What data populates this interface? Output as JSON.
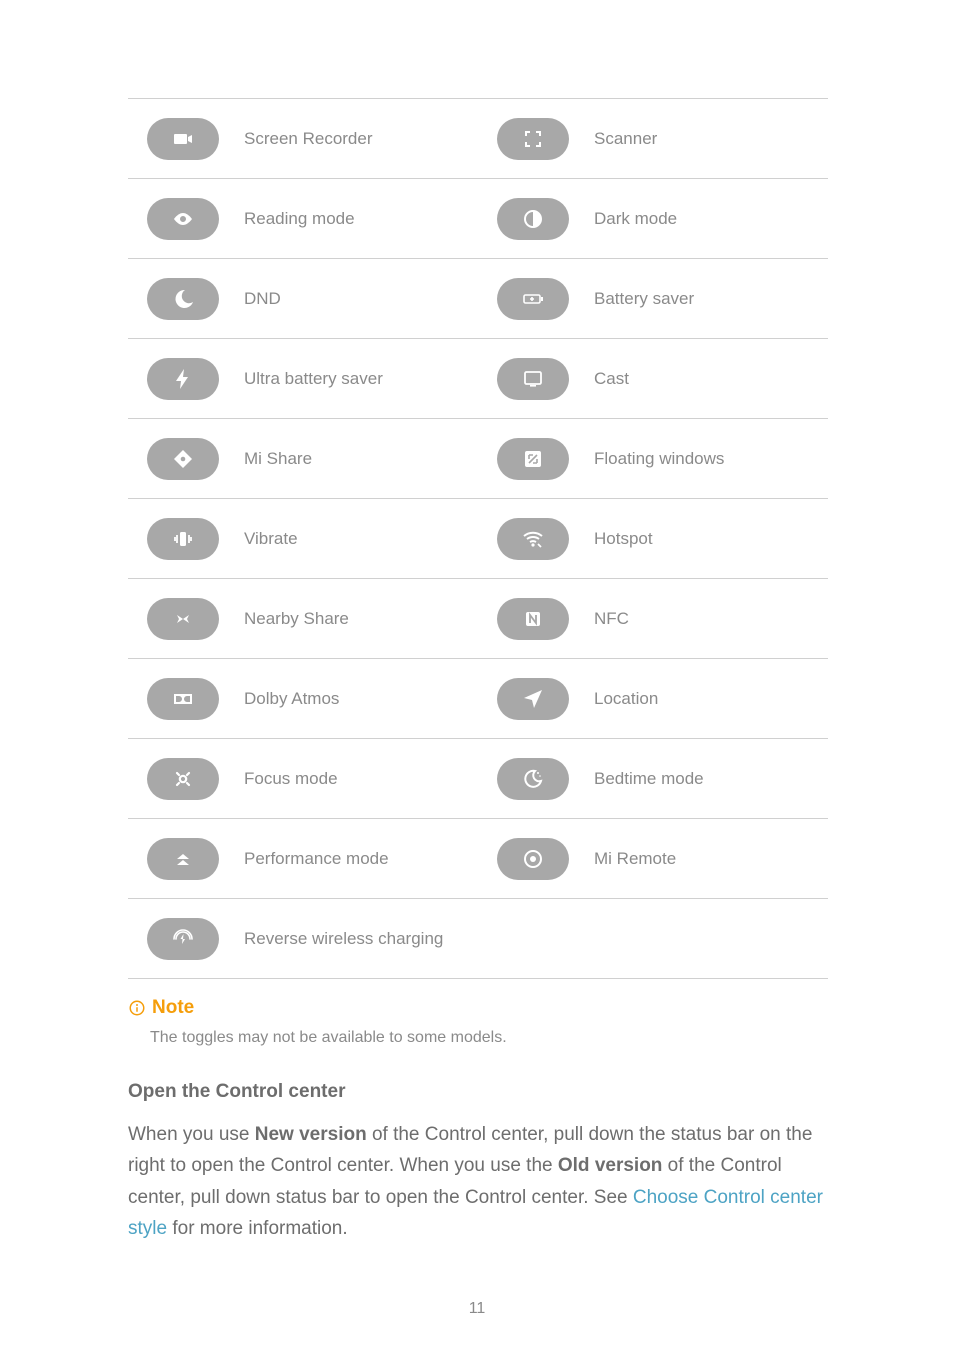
{
  "rows": [
    {
      "leftIcon": "camera-icon",
      "leftLabel": "Screen Recorder",
      "rightIcon": "scan-icon",
      "rightLabel": "Scanner"
    },
    {
      "leftIcon": "eye-icon",
      "leftLabel": "Reading mode",
      "rightIcon": "dark-mode-icon",
      "rightLabel": "Dark mode"
    },
    {
      "leftIcon": "moon-icon",
      "leftLabel": "DND",
      "rightIcon": "battery-plus-icon",
      "rightLabel": "Battery saver"
    },
    {
      "leftIcon": "bolt-icon",
      "leftLabel": "Ultra battery saver",
      "rightIcon": "cast-icon",
      "rightLabel": "Cast"
    },
    {
      "leftIcon": "share-diamond-icon",
      "leftLabel": "Mi Share",
      "rightIcon": "floating-window-icon",
      "rightLabel": "Floating windows"
    },
    {
      "leftIcon": "vibrate-icon",
      "leftLabel": "Vibrate",
      "rightIcon": "hotspot-icon",
      "rightLabel": "Hotspot"
    },
    {
      "leftIcon": "nearby-icon",
      "leftLabel": "Nearby Share",
      "rightIcon": "nfc-icon",
      "rightLabel": "NFC"
    },
    {
      "leftIcon": "dolby-icon",
      "leftLabel": "Dolby Atmos",
      "rightIcon": "location-icon",
      "rightLabel": "Location"
    },
    {
      "leftIcon": "focus-icon",
      "leftLabel": "Focus mode",
      "rightIcon": "bedtime-icon",
      "rightLabel": "Bedtime mode"
    },
    {
      "leftIcon": "performance-icon",
      "leftLabel": "Performance mode",
      "rightIcon": "remote-icon",
      "rightLabel": "Mi Remote"
    },
    {
      "leftIcon": "reverse-charge-icon",
      "leftLabel": "Reverse wireless charging",
      "rightIcon": "",
      "rightLabel": ""
    }
  ],
  "note": {
    "heading": "Note",
    "body": "The toggles may not be available to some models."
  },
  "section": {
    "heading": "Open the Control center",
    "para_a": "When you use ",
    "para_b": "New version",
    "para_c": " of the Control center, pull down the status bar on the right to open the Control center. When you use the ",
    "para_d": "Old version",
    "para_e": " of the Con­trol center, pull down status bar to open the Control center. See ",
    "para_link": "Choose Control center style",
    "para_f": " for more information."
  },
  "pageNumber": "11"
}
